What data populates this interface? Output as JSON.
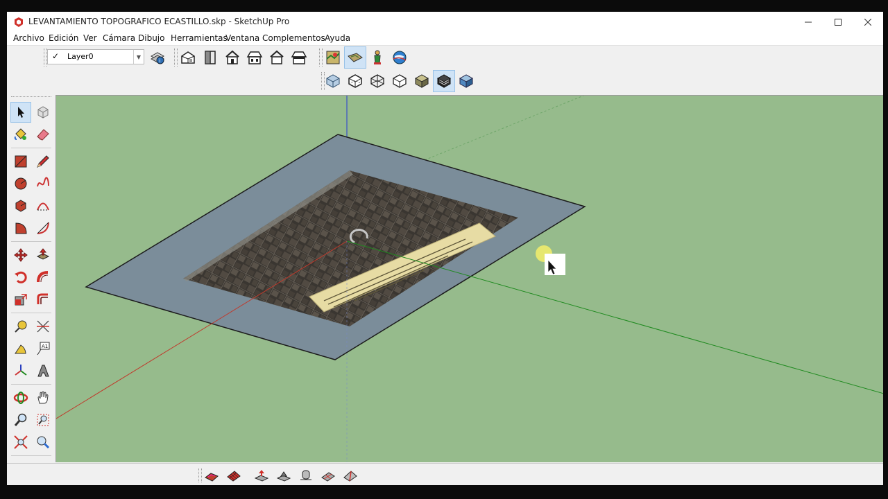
{
  "window": {
    "title": "LEVANTAMIENTO TOPOGRAFICO ECASTILLO.skp - SketchUp Pro",
    "controls": [
      "minimize",
      "maximize",
      "close"
    ]
  },
  "menu": [
    "Archivo",
    "Edición",
    "Ver",
    "Cámara",
    "Dibujo",
    "Herramientas",
    "Ventana",
    "Complementos",
    "Ayuda"
  ],
  "layers": {
    "current": "Layer0",
    "checked": true
  },
  "toolbars": {
    "views": [
      "iso-view",
      "top-view",
      "front-view",
      "right-view",
      "back-view",
      "left-view"
    ],
    "location": [
      "add-location",
      "toggle-terrain",
      "photo-textures",
      "preview-in-google-earth"
    ],
    "styles": [
      "xray",
      "back-edges",
      "wireframe",
      "hidden-line",
      "shaded",
      "shaded-with-textures",
      "monochrome"
    ],
    "active_style": "shaded-with-textures",
    "active_location": "toggle-terrain",
    "sandbox": [
      "from-contours",
      "from-scratch",
      "smoove",
      "stamp",
      "drape",
      "add-detail",
      "flip-edge"
    ]
  },
  "tools": [
    "select",
    "make-component",
    "paint-bucket",
    "eraser",
    "rectangle",
    "line",
    "circle",
    "freehand",
    "polygon",
    "arc",
    "pie",
    "two-point-arc",
    "move",
    "push-pull",
    "rotate",
    "follow-me",
    "scale",
    "offset",
    "tape-measure",
    "dimension",
    "protractor",
    "text",
    "axes",
    "3d-text",
    "orbit",
    "pan",
    "zoom",
    "zoom-window",
    "zoom-extents",
    "position-camera"
  ],
  "active_tool": "select",
  "colors": {
    "sky_ground": "#96bb8c",
    "plane": "#7a8c99",
    "axis_red": "#c0392b",
    "axis_green": "#1f8a1f",
    "axis_blue": "#2a3fbf",
    "highlight": "#cfe3f6"
  }
}
